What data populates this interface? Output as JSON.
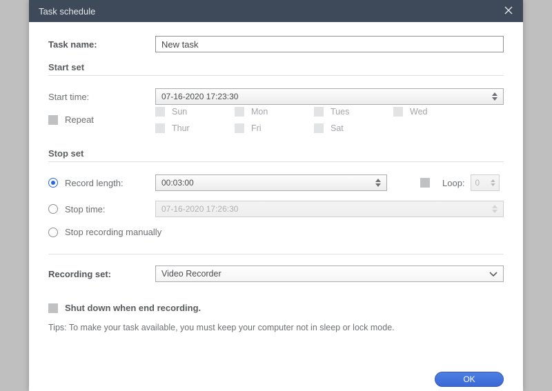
{
  "titlebar": {
    "title": "Task schedule"
  },
  "task_name": {
    "label": "Task name:",
    "value": "New task"
  },
  "start_set": {
    "title": "Start set",
    "start_time_label": "Start time:",
    "start_time_value": "07-16-2020 17:23:30",
    "repeat_label": "Repeat",
    "days": {
      "sun": "Sun",
      "mon": "Mon",
      "tues": "Tues",
      "wed": "Wed",
      "thur": "Thur",
      "fri": "Fri",
      "sat": "Sat"
    }
  },
  "stop_set": {
    "title": "Stop set",
    "record_length_label": "Record length:",
    "record_length_value": "00:03:00",
    "loop_label": "Loop:",
    "loop_value": "0",
    "stop_time_label": "Stop time:",
    "stop_time_value": "07-16-2020 17:26:30",
    "stop_manual_label": "Stop recording manually",
    "selected": "record_length"
  },
  "recording_set": {
    "label": "Recording set:",
    "value": "Video Recorder"
  },
  "shutdown": {
    "label": "Shut down when end recording."
  },
  "tips": "Tips: To make your task available, you must keep your computer not in sleep or lock mode.",
  "footer": {
    "ok": "OK"
  }
}
